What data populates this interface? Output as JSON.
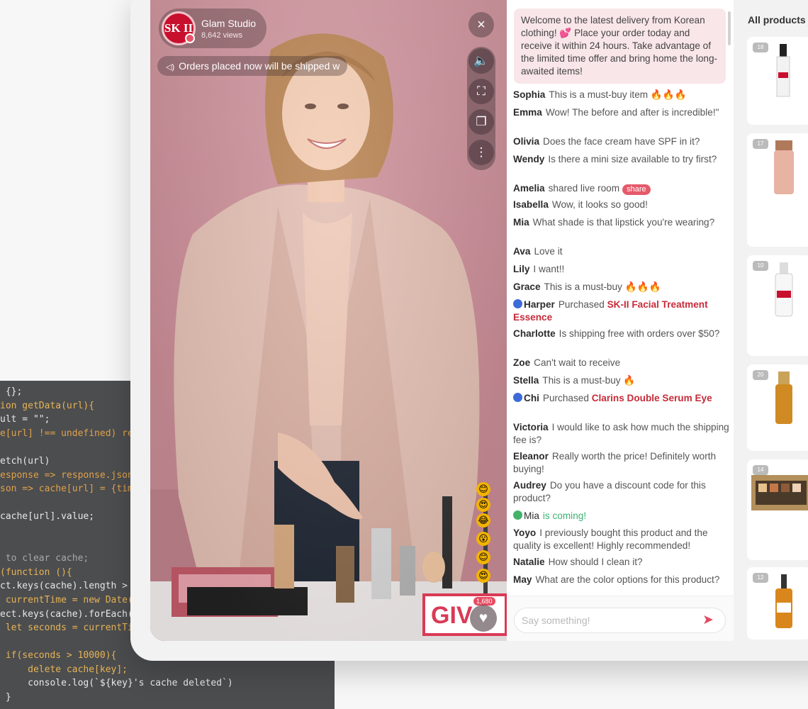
{
  "code": {
    "lines": [
      {
        "text": " {};",
        "kind": "plain"
      },
      {
        "text": "ion getData(url){",
        "kind": "kw"
      },
      {
        "text": "ult = \"\";",
        "kind": "plain"
      },
      {
        "text": "e[url] !== undefined) re",
        "kind": "op"
      },
      {
        "text": "",
        "kind": "plain"
      },
      {
        "text": "etch(url)",
        "kind": "plain"
      },
      {
        "text": "esponse => response.json",
        "kind": "op"
      },
      {
        "text": "son => cache[url] = {tim",
        "kind": "op"
      },
      {
        "text": "",
        "kind": "plain"
      },
      {
        "text": "cache[url].value;",
        "kind": "plain"
      },
      {
        "text": "",
        "kind": "plain"
      },
      {
        "text": "",
        "kind": "plain"
      },
      {
        "text": " to clear cache;",
        "kind": "cm"
      },
      {
        "text": "(function (){",
        "kind": "kw"
      },
      {
        "text": "ct.keys(cache).length >",
        "kind": "plain"
      },
      {
        "text": " currentTime = new Date(",
        "kind": "kw"
      },
      {
        "text": "ect.keys(cache).forEach(",
        "kind": "plain"
      },
      {
        "text": " let seconds = currentTi",
        "kind": "kw"
      },
      {
        "text": "",
        "kind": "plain"
      },
      {
        "text": " if(seconds > 10000){",
        "kind": "kw"
      },
      {
        "text": "     delete cache[key];",
        "kind": "kw"
      },
      {
        "text": "     console.log(`${key}'s cache deleted`)",
        "kind": "plain"
      },
      {
        "text": " }",
        "kind": "plain"
      }
    ]
  },
  "host": {
    "avatar_text": "SK II",
    "name": "Glam Studio",
    "views": "8,642 views"
  },
  "notice": {
    "icon": "speaker-icon",
    "text": "Orders placed now will be shipped w"
  },
  "controls": {
    "close": "×",
    "tools": [
      {
        "name": "volume-icon",
        "glyph": "🔈"
      },
      {
        "name": "fullscreen-icon",
        "glyph": "⛶"
      },
      {
        "name": "picture-in-picture-icon",
        "glyph": "❐"
      },
      {
        "name": "more-icon",
        "glyph": "⋮"
      }
    ]
  },
  "video": {
    "like_count": "1,680",
    "giveaway_text": "GIV",
    "reactions": [
      "😊",
      "😍",
      "😂",
      "😮",
      "😊",
      "😍"
    ]
  },
  "chat": {
    "welcome": "Welcome to the latest delivery from Korean clothing! 💕 Place your order today and receive it within 24 hours. Take advantage of the limited time offer and bring home the long-awaited items!",
    "messages": [
      {
        "user": "Sophia",
        "text": "This is a must-buy item 🔥🔥🔥"
      },
      {
        "user": "Emma",
        "text": "Wow! The before and after is incredible!\""
      },
      {
        "user": "Olivia",
        "text": "Does the face cream have SPF in it?"
      },
      {
        "user": "Wendy",
        "text": "Is there a mini size available to try first?"
      },
      {
        "user": "Amelia",
        "text": "shared live room",
        "share": "share"
      },
      {
        "user": "Isabella",
        "text": "Wow, it looks so good!"
      },
      {
        "user": "Mia",
        "text": "What shade is that lipstick you're wearing?"
      },
      {
        "user": "Ava",
        "text": "Love it"
      },
      {
        "user": "Lily",
        "text": "I want!!"
      },
      {
        "user": "Grace",
        "text": "This is a must-buy 🔥🔥🔥"
      },
      {
        "user": "Harper",
        "text": "Purchased",
        "product": "SK-II Facial Treatment Essence",
        "badge": "blue"
      },
      {
        "user": "Charlotte",
        "text": "Is shipping free with orders over $50?"
      },
      {
        "user": "Zoe",
        "text": "Can't wait to receive"
      },
      {
        "user": "Stella",
        "text": "This is a must-buy 🔥"
      },
      {
        "user": "Chi",
        "text": "Purchased",
        "product": "Clarins Double Serum Eye",
        "badge": "blue"
      },
      {
        "user": "Victoria",
        "text": "I would like to ask how much the shipping fee is?"
      },
      {
        "user": "Eleanor",
        "text": "Really worth the price! Definitely worth buying!"
      },
      {
        "user": "Audrey",
        "text": "Do you have a discount code for this product?"
      },
      {
        "user": "Mia",
        "text": "is coming!",
        "badge": "green",
        "green": true
      },
      {
        "user": "Yoyo",
        "text": "I previously bought this product and the quality is excellent! Highly recommended!"
      },
      {
        "user": "Natalie",
        "text": "How should I clean it?"
      },
      {
        "user": "May",
        "text": "What are the color options for this product?"
      }
    ],
    "input_placeholder": "Say something!",
    "send_icon": "send-icon"
  },
  "products": {
    "title": "All products",
    "items": [
      {
        "num": "18",
        "kind": "tall-bottle"
      },
      {
        "num": "17",
        "kind": "pink-bottle"
      },
      {
        "num": "10",
        "kind": "pump-bottle"
      },
      {
        "num": "20",
        "kind": "gold-serum"
      },
      {
        "num": "14",
        "kind": "palette"
      },
      {
        "num": "12",
        "kind": "dropper-bottle"
      }
    ]
  },
  "colors": {
    "accent": "#e04a60",
    "highlight": "#c62b39",
    "video_bg": "#c98b96"
  }
}
